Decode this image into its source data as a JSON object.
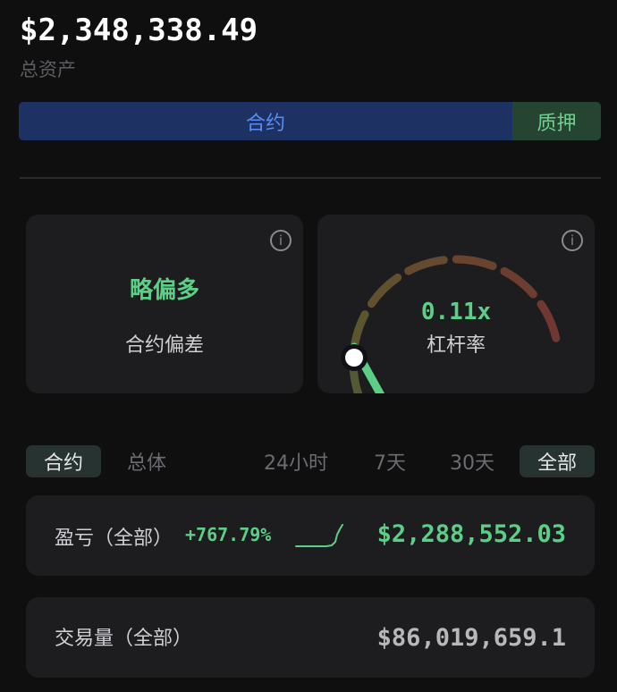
{
  "account": {
    "total_value": "$2,348,338.49",
    "total_label": "总资产"
  },
  "allocation": {
    "contract_label": "合约",
    "contract_color": "#1e3163",
    "collateral_label": "质押",
    "collateral_color": "#254532"
  },
  "bias_card": {
    "value": "略偏多",
    "label": "合约偏差",
    "info_icon": "info-icon"
  },
  "leverage_card": {
    "value": "0.11x",
    "label": "杠杆率",
    "gauge_level": 0.11,
    "info_icon": "info-icon"
  },
  "filters": {
    "scope_tabs": [
      "合约",
      "总体"
    ],
    "scope_active": "合约",
    "range_tabs": [
      "24小时",
      "7天",
      "30天",
      "全部"
    ],
    "range_active": "全部"
  },
  "pnl": {
    "label": "盈亏（全部）",
    "percent": "+767.79%",
    "amount": "$2,288,552.03",
    "color": "#5ccf87"
  },
  "volume": {
    "label": "交易量（全部）",
    "amount": "$86,019,659.1"
  }
}
